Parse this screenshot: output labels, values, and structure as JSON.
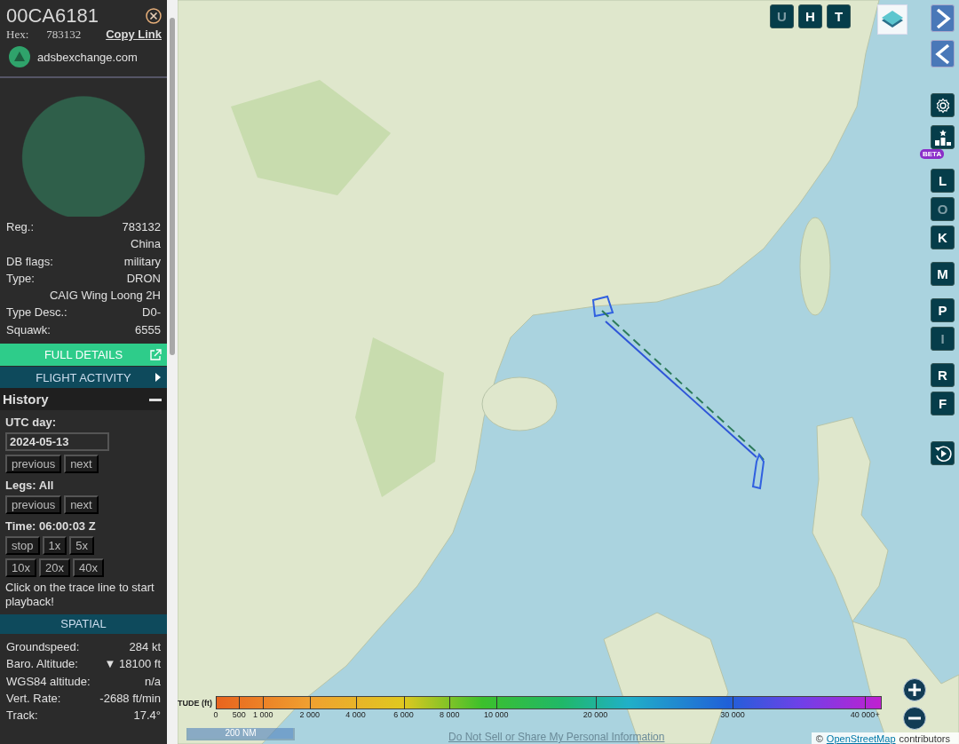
{
  "aircraft": {
    "callsign": "00CA6181",
    "hex_label": "Hex:",
    "hex": "783132",
    "copy_link": "Copy Link",
    "source": "adsbexchange.com"
  },
  "details": [
    {
      "label": "Reg.:",
      "value": "783132"
    },
    {
      "value": "China"
    },
    {
      "label": "DB flags:",
      "value": "military"
    },
    {
      "label": "Type:",
      "value": "DRON"
    },
    {
      "value": "CAIG Wing Loong 2H"
    },
    {
      "label": "Type Desc.:",
      "value": "D0-"
    },
    {
      "label": "Squawk:",
      "value": "6555"
    }
  ],
  "full_details": "FULL DETAILS",
  "flight_activity": "FLIGHT ACTIVITY",
  "history": {
    "title": "History",
    "expanded": true,
    "utc_label": "UTC day:",
    "date": "2024-05-13",
    "day_buttons": [
      "previous",
      "next"
    ],
    "legs_label": "Legs: All",
    "leg_buttons": [
      "previous",
      "next"
    ],
    "time_label": "Time: 06:00:03 Z",
    "speed_rows": [
      [
        "stop",
        "1x",
        "5x"
      ],
      [
        "10x",
        "20x",
        "40x"
      ]
    ],
    "hint": "Click on the trace line to start playback!"
  },
  "spatial": {
    "title": "SPATIAL",
    "rows": [
      {
        "label": "Groundspeed:",
        "value": "284 kt"
      },
      {
        "label": "Baro. Altitude:",
        "value": "▼ 18100 ft"
      },
      {
        "label": "WGS84 altitude:",
        "value": "n/a"
      },
      {
        "label": "Vert. Rate:",
        "value": "-2688 ft/min"
      },
      {
        "label": "Track:",
        "value": "17.4°"
      }
    ]
  },
  "top_buttons": [
    {
      "label": "U",
      "on": false
    },
    {
      "label": "H",
      "on": true
    },
    {
      "label": "T",
      "on": true
    }
  ],
  "beta_badge": "BETA",
  "toggles": [
    {
      "label": "L",
      "on": true
    },
    {
      "label": "O",
      "on": false
    },
    {
      "label": "K",
      "on": true
    },
    {
      "label": "M",
      "on": true
    },
    {
      "label": "P",
      "on": true
    },
    {
      "label": "I",
      "on": false
    },
    {
      "label": "R",
      "on": true
    },
    {
      "label": "F",
      "on": true
    }
  ],
  "legend": {
    "title": "TUDE (ft)",
    "ticks": [
      "0",
      "500",
      "1 000",
      "2 000",
      "4 000",
      "6 000",
      "8 000",
      "10 000",
      "20 000",
      "30 000",
      "40 000+"
    ]
  },
  "scale": "200 NM",
  "privacy_link": "Do Not Sell or Share My Personal Information",
  "attribution": {
    "prefix": "©",
    "link": "OpenStreetMap",
    "suffix": "contributors"
  }
}
